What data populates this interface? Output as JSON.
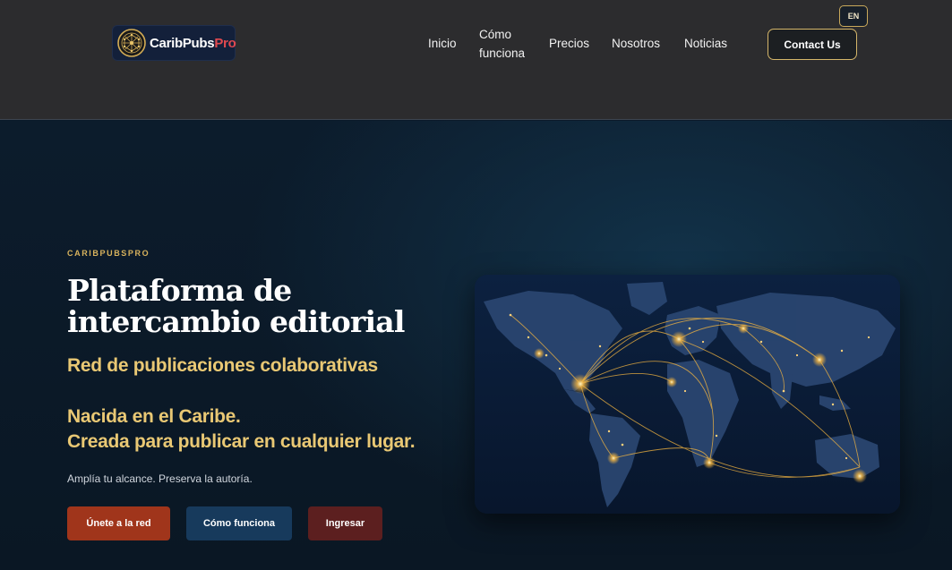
{
  "header": {
    "logo": {
      "text_primary": "CaribPubs",
      "text_accent": "Pro",
      "icon": "globe-network-icon"
    },
    "nav": [
      {
        "label": "Inicio"
      },
      {
        "label": "Cómo funciona"
      },
      {
        "label": "Precios"
      },
      {
        "label": "Nosotros"
      },
      {
        "label": "Noticias"
      }
    ],
    "lang_label": "EN",
    "contact_label": "Contact Us"
  },
  "hero": {
    "eyebrow": "CARIBPUBSPRO",
    "title": "Plataforma de intercambio editorial",
    "subtitle": "Red de publicaciones colaborativas",
    "tagline_line1": "Nacida en el Caribe.",
    "tagline_line2": "Creada para publicar en cualquier lugar.",
    "description": "Amplía tu alcance. Preserva la autoría.",
    "buttons": {
      "join": "Únete a la red",
      "how": "Cómo funciona",
      "login": "Ingresar"
    },
    "image": {
      "icon": "world-network-map-image"
    }
  },
  "colors": {
    "header_bg": "#2c2c2e",
    "hero_bg": "#0b1a2a",
    "gold": "#e9c874",
    "join_button": "#a0351b",
    "how_button": "#173a5c",
    "login_button": "#5c1f1f",
    "logo_accent": "#e0494f"
  }
}
